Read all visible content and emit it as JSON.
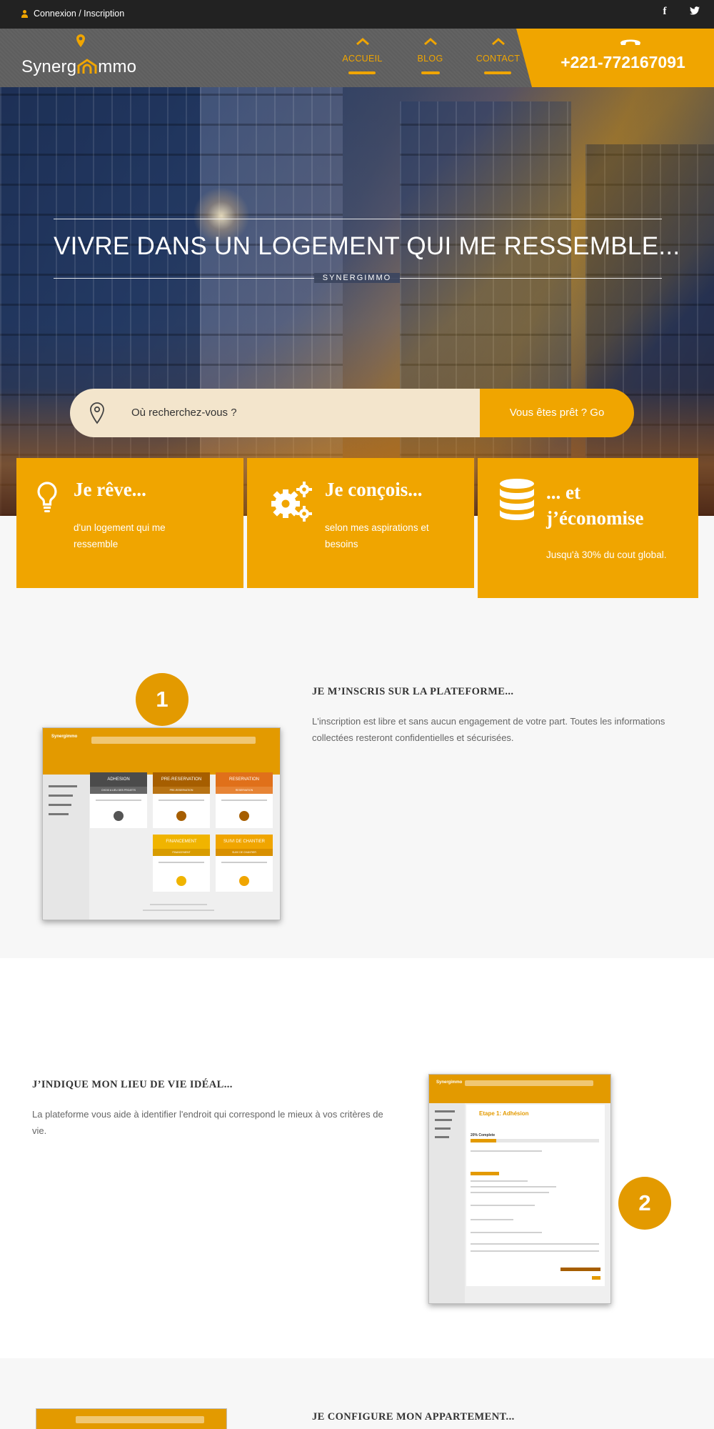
{
  "topbar": {
    "login_label": "Connexion / Inscription",
    "social": {
      "facebook": "f",
      "twitter": "★"
    }
  },
  "header": {
    "logo_text_a": "Synerg",
    "logo_text_b": "mmo",
    "nav": [
      {
        "label": "ACCUEIL"
      },
      {
        "label": "BLOG"
      },
      {
        "label": "CONTACT"
      }
    ],
    "phone": "+221-772167091"
  },
  "hero": {
    "title": "VIVRE DANS UN LOGEMENT QUI ME RESSEMBLE...",
    "subtitle": "SYNERGIMMO"
  },
  "search": {
    "placeholder": "Où recherchez-vous ?",
    "button": "Vous êtes prêt ? Go"
  },
  "features": [
    {
      "title": "Je rêve...",
      "text": "d'un logement qui me ressemble",
      "icon": "lightbulb-icon"
    },
    {
      "title": "Je conçois...",
      "text": "selon mes aspirations et besoins",
      "icon": "gears-icon"
    },
    {
      "title": "... et j’économise",
      "text": "Jusqu'à 30% du cout global.",
      "icon": "database-icon"
    }
  ],
  "steps": [
    {
      "number": "1",
      "title": "JE M’INSCRIS SUR LA PLATEFORME...",
      "text": "L'inscription est libre et sans aucun engagement de votre part. Toutes les informations collectées resteront confidentielles et sécurisées."
    },
    {
      "number": "2",
      "title": "J’INDIQUE MON LIEU DE VIE IDÉAL...",
      "text": "La plateforme vous aide à identifier l'endroit qui correspond le mieux à vos critères de vie."
    },
    {
      "title": "JE CONFIGURE MON APPARTEMENT..."
    }
  ],
  "mock1": {
    "logo": "Synergimmo",
    "cards": [
      {
        "title": "ADHESION",
        "sub": "CHOIX A LIEU DES PROJETS",
        "color": "#4b4b4b"
      },
      {
        "title": "PRE-RESERVATION",
        "sub": "PRE-RESERVATION",
        "color": "#a65e00"
      },
      {
        "title": "RESERVATION",
        "sub": "RESERVATION",
        "color": "#e0701a"
      },
      {
        "title": "FINANCEMENT",
        "sub": "FINANCEMENT",
        "color": "#f0b400"
      },
      {
        "title": "SUIVI DE CHANTIER",
        "sub": "SUIVI DE CHANTIER",
        "color": "#f0a500"
      }
    ]
  },
  "mock2": {
    "logo": "Synergimmo",
    "step_title": "Etape 1: Adhésion",
    "progress": "20% Complete"
  },
  "colors": {
    "accent": "#f0a500",
    "dark": "#222222",
    "header": "#5e5e5e"
  }
}
